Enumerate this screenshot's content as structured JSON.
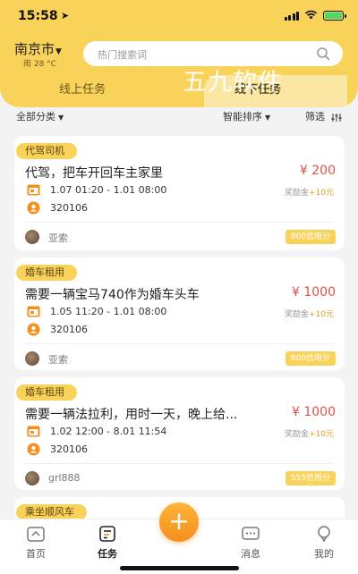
{
  "status": {
    "time": "15:58"
  },
  "header": {
    "city": "南京市",
    "weather": "雨 28 °C",
    "search_placeholder": "热门搜索词",
    "tabs": [
      {
        "label": "线上任务"
      },
      {
        "label": "线下任务"
      }
    ],
    "watermark": "五九软件"
  },
  "filters": {
    "category": "全部分类",
    "sort": "智能排序",
    "screen": "筛选"
  },
  "tasks": [
    {
      "category": "代驾司机",
      "title": "代驾，把车开回车主家里",
      "price": "¥ 200",
      "time": "1.07 01:20 - 1.01 08:00",
      "bonus_label": "奖励金",
      "bonus": "+10元",
      "code": "320106",
      "user": "亚索",
      "credit": "800信用分"
    },
    {
      "category": "婚车租用",
      "title": "需要一辆宝马740作为婚车头车",
      "price": "¥ 1000",
      "time": "1.05 11:20 - 1.01 08:00",
      "bonus_label": "奖励金",
      "bonus": "+10元",
      "code": "320106",
      "user": "亚索",
      "credit": "800信用分"
    },
    {
      "category": "婚车租用",
      "title": "需要一辆法拉利，用时一天，晚上给...",
      "price": "¥ 1000",
      "time": "1.02 12:00 - 8.01 11:54",
      "bonus_label": "奖励金",
      "bonus": "+10元",
      "code": "320106",
      "user": "grl888",
      "credit": "555信用分"
    },
    {
      "category": "乘坐顺风车"
    }
  ],
  "tabbar": {
    "items": [
      {
        "label": "首页",
        "icon": "home-icon"
      },
      {
        "label": "任务",
        "icon": "task-icon"
      },
      {
        "label": "消息",
        "icon": "message-icon"
      },
      {
        "label": "我的",
        "icon": "profile-icon"
      }
    ],
    "publish_icon": "plus-icon",
    "publish_glyph": "+"
  },
  "colors": {
    "brand": "#f9d25a",
    "price": "#e0504a",
    "accent": "#f38f1e"
  }
}
